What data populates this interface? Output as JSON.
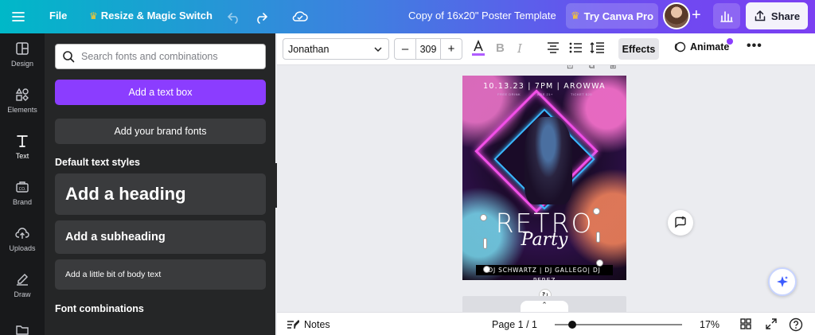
{
  "topbar": {
    "file_label": "File",
    "resize_label": "Resize & Magic Switch",
    "doc_title": "Copy of 16x20\" Poster Template",
    "pro_label": "Try Canva Pro",
    "share_label": "Share"
  },
  "nav": {
    "items": [
      {
        "label": "Design",
        "icon": "layout-icon"
      },
      {
        "label": "Elements",
        "icon": "shapes-icon"
      },
      {
        "label": "Text",
        "icon": "text-icon"
      },
      {
        "label": "Brand",
        "icon": "brand-icon"
      },
      {
        "label": "Uploads",
        "icon": "upload-cloud-icon"
      },
      {
        "label": "Draw",
        "icon": "pen-icon"
      }
    ],
    "active": "Text"
  },
  "panel": {
    "search_placeholder": "Search fonts and combinations",
    "add_text_box": "Add a text box",
    "add_brand_fonts": "Add your brand fonts",
    "default_styles_label": "Default text styles",
    "heading": "Add a heading",
    "subheading": "Add a subheading",
    "body": "Add a little bit of body text",
    "font_combinations_label": "Font combinations"
  },
  "toolbar": {
    "font": "Jonathan",
    "size_value": "309",
    "size_minus": "–",
    "size_plus": "+",
    "effects_label": "Effects",
    "animate_label": "Animate",
    "more_label": "•••"
  },
  "poster": {
    "top_line": "10.13.23 | 7PM | AROWWA",
    "sub_left": "FREE DRINK",
    "sub_mid": "AGE 21+",
    "sub_right": "TICKET $20",
    "title": "RETRO",
    "script": "Party",
    "djs": "DJ SCHWARTZ | DJ GALLEGO| DJ PEREZ"
  },
  "bottombar": {
    "notes_label": "Notes",
    "page_info": "Page 1 / 1",
    "zoom_pct": "17%",
    "zoom_fraction": 0.17
  },
  "colors": {
    "accent_purple": "#8b3dff",
    "panel_bg": "#252627",
    "nav_bg": "#18191b"
  }
}
